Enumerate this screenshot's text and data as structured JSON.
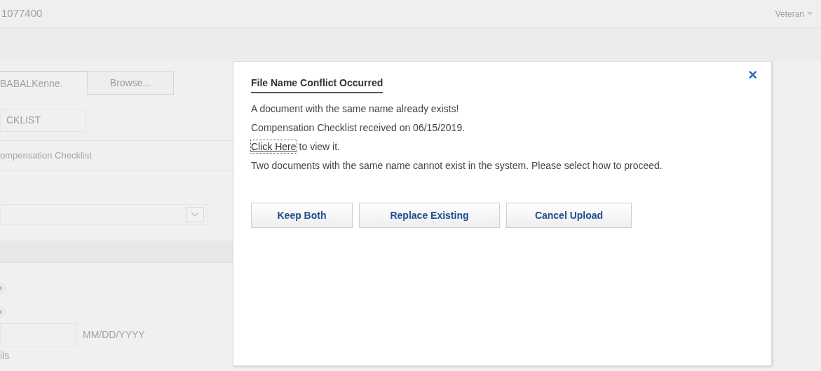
{
  "header": {
    "id_text": "1077400",
    "user_menu": "Veteran"
  },
  "form": {
    "file_field": {
      "value": "BABALKenne."
    },
    "browse_button": "Browse...",
    "type_field": {
      "value": "CKLIST"
    },
    "description": "ompensation Checklist",
    "radios": [
      {
        "selected": true
      },
      {
        "selected": true
      }
    ],
    "date_hint": "MM/DD/YYYY",
    "cut_label": "ils"
  },
  "dialog": {
    "title": "File Name Conflict Occurred",
    "close": "×",
    "lines": [
      {
        "kind": "text",
        "text": "A document with the same name already exists!"
      },
      {
        "kind": "text",
        "text": "Compensation Checklist received on 06/15/2019."
      },
      {
        "kind": "link",
        "link": "Click Here",
        "text": "to view it."
      },
      {
        "kind": "text",
        "text": "Two documents with the same name cannot exist in the system. Please select how to proceed."
      }
    ],
    "buttons": [
      "Keep Both",
      "Replace Existing",
      "Cancel Upload"
    ]
  }
}
